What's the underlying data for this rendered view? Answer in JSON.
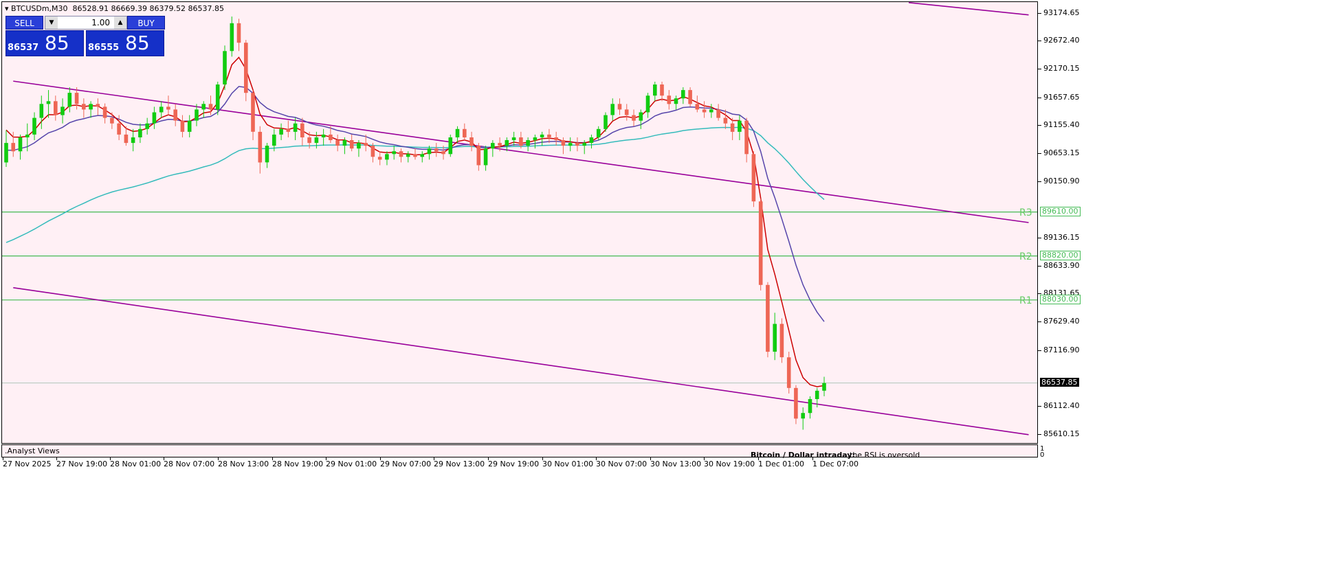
{
  "header": {
    "symbol": "BTCUSDm,M30",
    "ohlc": "86528.91 86669.39 86379.52 86537.85"
  },
  "trade_panel": {
    "sell_label": "SELL",
    "buy_label": "BUY",
    "lot": "1.00",
    "sell_price_small": "86537",
    "sell_price_big": "85",
    "buy_price_small": "86555",
    "buy_price_big": "85"
  },
  "analyst": {
    "label": ".Analyst Views",
    "title": "Bitcoin / Dollar intraday:",
    "text": "the RSI is oversold"
  },
  "subwindow_ticks": [
    "1",
    "0"
  ],
  "colors": {
    "background": "#fff0f5",
    "bull": "#11cc11",
    "bear": "#ee6655",
    "channel": "#990099",
    "ma_fast": "#cc0000",
    "ma_mid": "#5544aa",
    "ma_slow": "#33bbbb",
    "levels": "#44bb55"
  },
  "chart_data": {
    "type": "candlestick",
    "y_ticks": [
      "93174.65",
      "92672.40",
      "92170.15",
      "91657.65",
      "91155.40",
      "90653.15",
      "90150.90",
      "89136.15",
      "88633.90",
      "88131.65",
      "87629.40",
      "87116.90",
      "86112.40",
      "85610.15"
    ],
    "x_ticks": [
      "27 Nov 2025",
      "27 Nov 19:00",
      "28 Nov 01:00",
      "28 Nov 07:00",
      "28 Nov 13:00",
      "28 Nov 19:00",
      "29 Nov 01:00",
      "29 Nov 07:00",
      "29 Nov 13:00",
      "29 Nov 19:00",
      "30 Nov 01:00",
      "30 Nov 07:00",
      "30 Nov 13:00",
      "30 Nov 19:00",
      "1 Dec 01:00",
      "1 Dec 07:00"
    ],
    "ylim": [
      85460,
      93380
    ],
    "last_price": 86537.85,
    "last_price_label": "86537.85",
    "levels": [
      {
        "name": "R3",
        "price": 89610.0,
        "label": "89610.00"
      },
      {
        "name": "R2",
        "price": 88820.0,
        "label": "88820.00"
      },
      {
        "name": "R1",
        "price": 88030.0,
        "label": "88030.00"
      }
    ],
    "channel_lines": [
      {
        "from": [
          1,
          91960
        ],
        "to": [
          145,
          89420
        ]
      },
      {
        "from": [
          1,
          88250
        ],
        "to": [
          145,
          85610
        ]
      },
      {
        "from": [
          128,
          93370
        ],
        "to": [
          145,
          93150
        ]
      }
    ],
    "candles": [
      [
        90500,
        91080,
        90420,
        90850
      ],
      [
        90850,
        91050,
        90600,
        90700
      ],
      [
        90700,
        91000,
        90550,
        90950
      ],
      [
        90950,
        91200,
        90700,
        91000
      ],
      [
        91000,
        91400,
        90900,
        91300
      ],
      [
        91300,
        91700,
        91100,
        91550
      ],
      [
        91550,
        91800,
        91300,
        91600
      ],
      [
        91600,
        91700,
        91250,
        91350
      ],
      [
        91350,
        91650,
        91200,
        91500
      ],
      [
        91500,
        91850,
        91400,
        91750
      ],
      [
        91750,
        91850,
        91450,
        91550
      ],
      [
        91550,
        91650,
        91300,
        91450
      ],
      [
        91450,
        91600,
        91300,
        91550
      ],
      [
        91550,
        91650,
        91350,
        91500
      ],
      [
        91500,
        91560,
        91200,
        91300
      ],
      [
        91300,
        91400,
        91100,
        91200
      ],
      [
        91200,
        91350,
        90900,
        91000
      ],
      [
        91000,
        91150,
        90800,
        90850
      ],
      [
        90850,
        91100,
        90700,
        90950
      ],
      [
        90950,
        91200,
        90850,
        91100
      ],
      [
        91100,
        91300,
        91000,
        91200
      ],
      [
        91200,
        91500,
        91100,
        91400
      ],
      [
        91400,
        91600,
        91300,
        91500
      ],
      [
        91500,
        91700,
        91350,
        91450
      ],
      [
        91450,
        91550,
        91150,
        91250
      ],
      [
        91250,
        91350,
        90950,
        91050
      ],
      [
        91050,
        91350,
        90950,
        91250
      ],
      [
        91250,
        91550,
        91150,
        91450
      ],
      [
        91450,
        91600,
        91300,
        91550
      ],
      [
        91550,
        91700,
        91350,
        91450
      ],
      [
        91450,
        91950,
        91350,
        91900
      ],
      [
        91900,
        92600,
        91800,
        92500
      ],
      [
        92500,
        93120,
        92400,
        93000
      ],
      [
        93000,
        93080,
        92500,
        92650
      ],
      [
        92650,
        92700,
        91600,
        91750
      ],
      [
        91750,
        91800,
        90900,
        91050
      ],
      [
        91050,
        91150,
        90300,
        90500
      ],
      [
        90500,
        90850,
        90400,
        90800
      ],
      [
        90800,
        91100,
        90700,
        91000
      ],
      [
        91000,
        91200,
        90900,
        91100
      ],
      [
        91100,
        91250,
        90950,
        91050
      ],
      [
        91050,
        91300,
        90900,
        91200
      ],
      [
        91200,
        91300,
        90800,
        90950
      ],
      [
        90950,
        91050,
        90750,
        90850
      ],
      [
        90850,
        91050,
        90750,
        90950
      ],
      [
        90950,
        91100,
        90800,
        91000
      ],
      [
        91000,
        91150,
        90850,
        90900
      ],
      [
        90900,
        91000,
        90700,
        90800
      ],
      [
        90800,
        90950,
        90650,
        90900
      ],
      [
        90900,
        91000,
        90700,
        90750
      ],
      [
        90750,
        90900,
        90600,
        90850
      ],
      [
        90850,
        91000,
        90700,
        90800
      ],
      [
        90800,
        90850,
        90500,
        90600
      ],
      [
        90600,
        90700,
        90450,
        90550
      ],
      [
        90550,
        90700,
        90450,
        90650
      ],
      [
        90650,
        90800,
        90550,
        90700
      ],
      [
        90700,
        90750,
        90500,
        90600
      ],
      [
        90600,
        90700,
        90500,
        90650
      ],
      [
        90650,
        90750,
        90550,
        90600
      ],
      [
        90600,
        90700,
        90500,
        90650
      ],
      [
        90650,
        90800,
        90550,
        90750
      ],
      [
        90750,
        90850,
        90600,
        90700
      ],
      [
        90700,
        90800,
        90550,
        90650
      ],
      [
        90650,
        91000,
        90600,
        90950
      ],
      [
        90950,
        91150,
        90850,
        91100
      ],
      [
        91100,
        91200,
        90900,
        90950
      ],
      [
        90950,
        91050,
        90700,
        90800
      ],
      [
        90800,
        90850,
        90350,
        90450
      ],
      [
        90450,
        90800,
        90350,
        90750
      ],
      [
        90750,
        90900,
        90600,
        90850
      ],
      [
        90850,
        90950,
        90700,
        90800
      ],
      [
        90800,
        90950,
        90700,
        90900
      ],
      [
        90900,
        91050,
        90800,
        90950
      ],
      [
        90950,
        91050,
        90750,
        90800
      ],
      [
        90800,
        90950,
        90700,
        90900
      ],
      [
        90900,
        91000,
        90750,
        90950
      ],
      [
        90950,
        91050,
        90800,
        91000
      ],
      [
        91000,
        91100,
        90850,
        90950
      ],
      [
        90950,
        91050,
        90800,
        90900
      ],
      [
        90900,
        90950,
        90650,
        90800
      ],
      [
        90800,
        90950,
        90700,
        90850
      ],
      [
        90850,
        90950,
        90700,
        90800
      ],
      [
        90800,
        90900,
        90650,
        90850
      ],
      [
        90850,
        91000,
        90750,
        90950
      ],
      [
        90950,
        91150,
        90900,
        91100
      ],
      [
        91100,
        91400,
        91050,
        91350
      ],
      [
        91350,
        91650,
        91250,
        91550
      ],
      [
        91550,
        91650,
        91350,
        91450
      ],
      [
        91450,
        91550,
        91250,
        91350
      ],
      [
        91350,
        91450,
        91150,
        91250
      ],
      [
        91250,
        91450,
        91100,
        91400
      ],
      [
        91400,
        91750,
        91300,
        91700
      ],
      [
        91700,
        91950,
        91600,
        91900
      ],
      [
        91900,
        91950,
        91600,
        91700
      ],
      [
        91700,
        91800,
        91450,
        91550
      ],
      [
        91550,
        91700,
        91450,
        91650
      ],
      [
        91650,
        91850,
        91550,
        91800
      ],
      [
        91800,
        91850,
        91500,
        91550
      ],
      [
        91550,
        91700,
        91400,
        91450
      ],
      [
        91450,
        91600,
        91300,
        91400
      ],
      [
        91400,
        91550,
        91300,
        91450
      ],
      [
        91450,
        91550,
        91250,
        91300
      ],
      [
        91300,
        91450,
        91100,
        91200
      ],
      [
        91200,
        91300,
        90900,
        91050
      ],
      [
        91050,
        91350,
        90900,
        91250
      ],
      [
        91250,
        91300,
        90500,
        90650
      ],
      [
        90650,
        90700,
        89700,
        89800
      ],
      [
        89800,
        89850,
        88200,
        88300
      ],
      [
        88300,
        88350,
        87000,
        87100
      ],
      [
        87100,
        87800,
        86950,
        87600
      ],
      [
        87600,
        87700,
        86900,
        87000
      ],
      [
        87000,
        87100,
        86350,
        86450
      ],
      [
        86450,
        86500,
        85800,
        85900
      ],
      [
        85900,
        86100,
        85700,
        86000
      ],
      [
        86000,
        86300,
        85900,
        86250
      ],
      [
        86250,
        86450,
        86100,
        86400
      ],
      [
        86400,
        86650,
        86300,
        86537.85
      ]
    ]
  }
}
